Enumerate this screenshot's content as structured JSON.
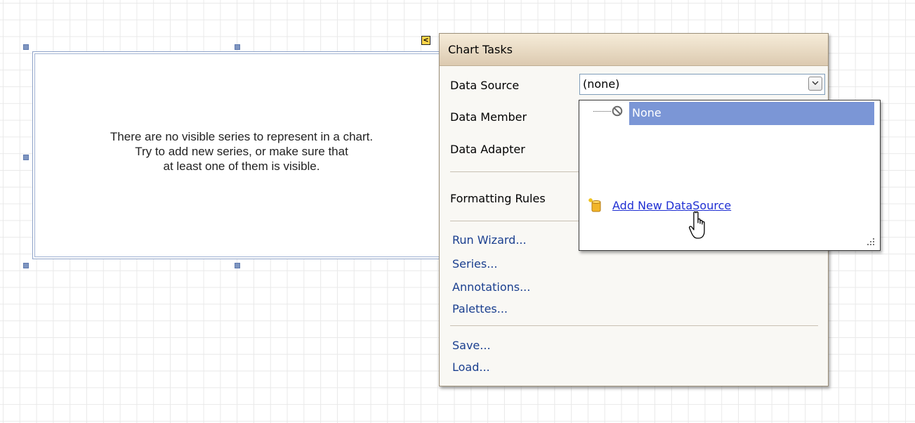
{
  "chart": {
    "message_lines": [
      "There are no visible series to represent in a chart.",
      "Try to add new series, or make sure that",
      "at least one of them is visible."
    ]
  },
  "smart_tag": {
    "glyph": "<"
  },
  "tasks": {
    "title": "Chart Tasks",
    "data_source_label": "Data Source",
    "data_source_value": "(none)",
    "data_member_label": "Data Member",
    "data_adapter_label": "Data Adapter",
    "formatting_rules_label": "Formatting Rules",
    "links": [
      "Run Wizard...",
      "Series...",
      "Annotations...",
      "Palettes..."
    ],
    "file_links": [
      "Save...",
      "Load..."
    ]
  },
  "dropdown": {
    "none_label": "None",
    "add_label": "Add New DataSource"
  },
  "colors": {
    "selection": "#7b96d6",
    "link": "#1a3f8f",
    "header_top": "#f6ecd9",
    "header_bottom": "#dccab0"
  },
  "icons": [
    "none-icon",
    "add-datasource-icon",
    "chevron-down-icon",
    "hand-cursor-icon",
    "resize-grip-icon"
  ]
}
